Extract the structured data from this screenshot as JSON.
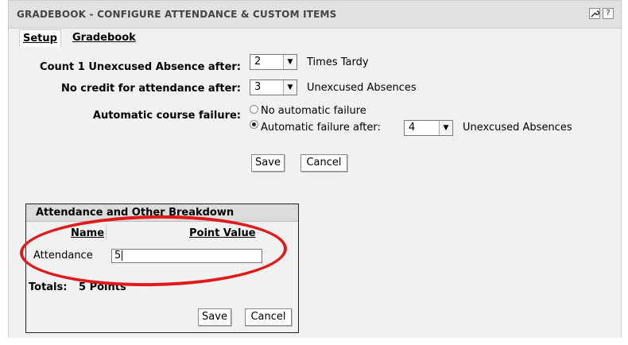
{
  "header": {
    "title": "GRADEBOOK - CONFIGURE ATTENDANCE & CUSTOM ITEMS",
    "tool_icon": "wrench-icon",
    "help_label": "?"
  },
  "tabs": [
    {
      "label": "Setup",
      "active": true
    },
    {
      "label": "Gradebook",
      "active": false
    }
  ],
  "settings": {
    "unexcused_label": "Count 1 Unexcused Absence after:",
    "unexcused_value": "2",
    "unexcused_suffix": "Times Tardy",
    "nocredit_label": "No credit for attendance after:",
    "nocredit_value": "3",
    "nocredit_suffix": "Unexcused Absences",
    "failure_label": "Automatic course failure:",
    "failure_options": [
      {
        "label": "No automatic failure",
        "selected": false
      },
      {
        "label": "Automatic failure after:",
        "selected": true
      }
    ],
    "failure_value": "4",
    "failure_suffix": "Unexcused Absences",
    "save_label": "Save",
    "cancel_label": "Cancel"
  },
  "breakdown": {
    "title": "Attendance and Other Breakdown",
    "col_name": "Name",
    "col_points": "Point Value",
    "rows": [
      {
        "name": "Attendance",
        "value": "5"
      }
    ],
    "totals_label": "Totals:",
    "totals_value": "5 Points",
    "save_label": "Save",
    "cancel_label": "Cancel"
  },
  "annotation": {
    "color": "#e01a1a"
  }
}
